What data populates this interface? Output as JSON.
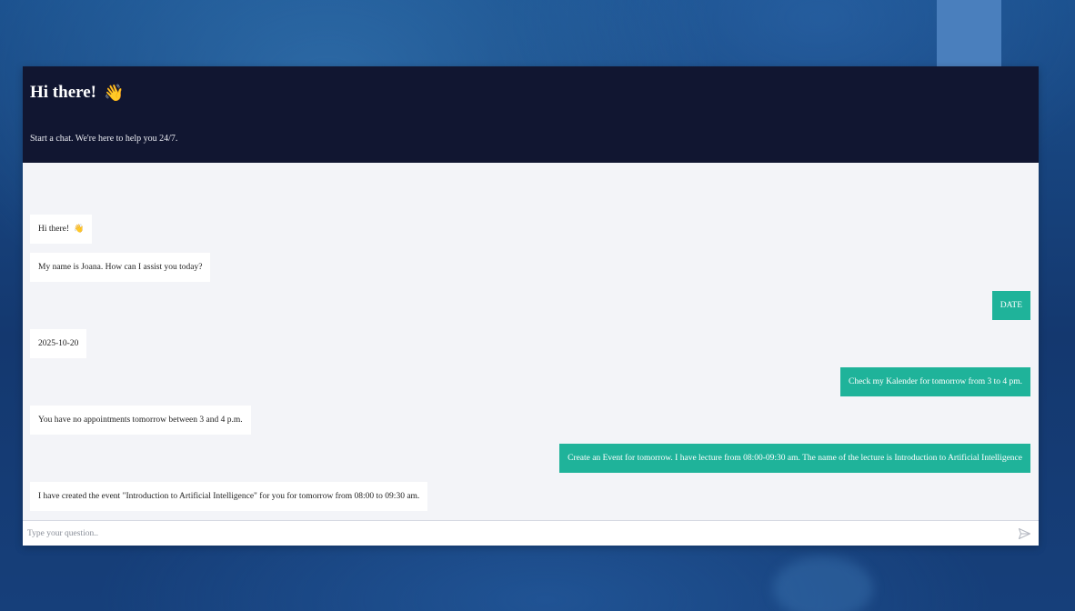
{
  "header": {
    "title": "Hi there!",
    "title_emoji": "👋",
    "subtitle": "Start a chat. We're here to help you 24/7."
  },
  "messages": [
    {
      "sender": "bot",
      "text": "Hi there!",
      "emoji": "👋"
    },
    {
      "sender": "bot",
      "text": "My name is Joana. How can I assist you today?"
    },
    {
      "sender": "user",
      "text": "DATE"
    },
    {
      "sender": "bot",
      "text": "2025-10-20"
    },
    {
      "sender": "user",
      "text": "Check my Kalender for tomorrow from 3 to 4 pm."
    },
    {
      "sender": "bot",
      "text": "You have no appointments tomorrow between 3 and 4 p.m."
    },
    {
      "sender": "user",
      "text": "Create an Event for tomorrow. I have lecture from 08:00-09:30 am. The name of the lecture is Introduction to Artificial Intelligence"
    },
    {
      "sender": "bot",
      "text": "I have created the event \"Introduction to Artificial Intelligence\" for you for tomorrow from 08:00 to 09:30 am."
    }
  ],
  "composer": {
    "placeholder": "Type your question..",
    "value": "",
    "send_icon": "send-icon"
  },
  "colors": {
    "header_bg": "#111631",
    "user_bubble": "#1fb39a",
    "bot_bubble": "#ffffff",
    "chat_bg": "#f3f4f8"
  }
}
